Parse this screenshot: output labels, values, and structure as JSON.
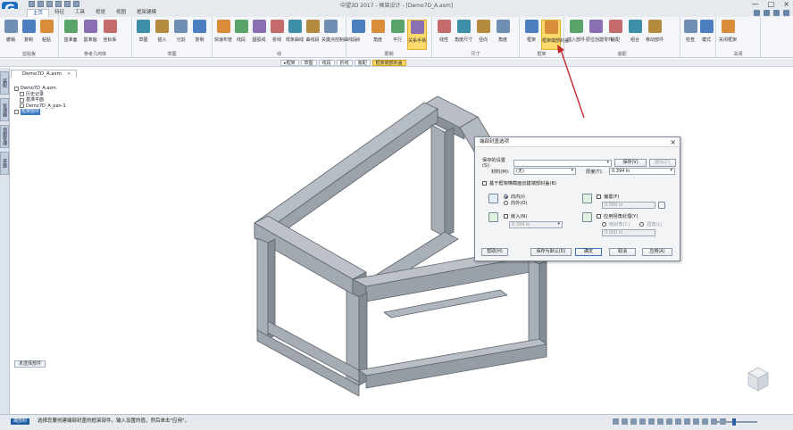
{
  "window": {
    "title": "中望3D 2017 - 框架设计 - [Demo7D_A.asm]",
    "controls": [
      "—",
      "□",
      "×"
    ]
  },
  "ribbon_tabs": [
    {
      "label": "主页",
      "active": true
    },
    {
      "label": "特征",
      "active": false
    },
    {
      "label": "工具",
      "active": false
    },
    {
      "label": "视觉",
      "active": false
    },
    {
      "label": "视图",
      "active": false
    },
    {
      "label": "框架建模",
      "active": false
    }
  ],
  "ribbon": {
    "groups": [
      {
        "label": "剪贴板",
        "buttons": [
          {
            "label": "撤销",
            "icon": "undo-icon"
          },
          {
            "label": "复制",
            "icon": "copy-icon"
          },
          {
            "label": "粘贴",
            "icon": "paste-icon"
          }
        ]
      },
      {
        "label": "参考几何体",
        "buttons": [
          {
            "label": "基准面",
            "icon": "plane-icon"
          },
          {
            "label": "基准轴",
            "icon": "axis-icon"
          },
          {
            "label": "坐标系",
            "icon": "csys-icon"
          }
        ]
      },
      {
        "label": "草图",
        "buttons": [
          {
            "label": "草图",
            "icon": "sketch-icon"
          },
          {
            "label": "插入",
            "icon": "insert-icon"
          },
          {
            "label": "分割",
            "icon": "split-icon"
          },
          {
            "label": "复制",
            "icon": "copy2-icon"
          }
        ]
      },
      {
        "label": "线",
        "buttons": [
          {
            "label": "快速布管",
            "icon": "route-icon"
          },
          {
            "label": "线段",
            "icon": "line-icon"
          },
          {
            "label": "圆弧线",
            "icon": "arc-icon"
          },
          {
            "label": "折线",
            "icon": "polyline-icon"
          },
          {
            "label": "样条曲线",
            "icon": "spline-icon"
          },
          {
            "label": "曲线段",
            "icon": "curve-icon"
          },
          {
            "label": "关键点控制曲线段",
            "icon": "keycurve-icon"
          }
        ]
      },
      {
        "label": "限制",
        "buttons": [
          {
            "label": "点",
            "icon": "point-icon"
          },
          {
            "label": "角度",
            "icon": "angle-icon"
          },
          {
            "label": "平行",
            "icon": "parallel-icon"
          },
          {
            "label": "关系手柄",
            "icon": "relation-icon",
            "highlight": true
          }
        ]
      },
      {
        "label": "尺寸",
        "buttons": [
          {
            "label": "线性",
            "icon": "linear-icon"
          },
          {
            "label": "角度尺寸",
            "icon": "angledim-icon"
          },
          {
            "label": "径向",
            "icon": "radial-icon"
          },
          {
            "label": "角度",
            "icon": "angle2-icon"
          }
        ]
      },
      {
        "label": "框架",
        "buttons": [
          {
            "label": "框架",
            "icon": "frame-icon"
          },
          {
            "label": "框架端部封盖",
            "icon": "endcap-icon",
            "highlight": true
          }
        ]
      },
      {
        "label": "装配",
        "buttons": [
          {
            "label": "插入部件",
            "icon": "insertpart-icon"
          },
          {
            "label": "原位创建零件",
            "icon": "inplace-icon"
          },
          {
            "label": "装配",
            "icon": "assembly-icon"
          },
          {
            "label": "组合",
            "icon": "combine-icon"
          },
          {
            "label": "移动部件",
            "icon": "move-icon"
          }
        ]
      },
      {
        "label": "",
        "buttons": [
          {
            "label": "检查",
            "icon": "check-icon"
          },
          {
            "label": "模式",
            "icon": "mode-icon"
          }
        ]
      },
      {
        "label": "关闭",
        "buttons": [
          {
            "label": "关闭框架",
            "icon": "close-frame-icon"
          }
        ]
      }
    ]
  },
  "breadcrumb": [
    {
      "label": "▸框架",
      "active": false
    },
    {
      "label": "草图",
      "active": false
    },
    {
      "label": "线段",
      "active": false
    },
    {
      "label": "折线",
      "active": false
    },
    {
      "label": "装配",
      "active": false
    },
    {
      "label": "框架端部封盖",
      "active": true
    }
  ],
  "left_rail": [
    "装配",
    "管理器",
    "视图管理",
    "草图"
  ],
  "document_tab": {
    "label": "Demo7D_A.asm",
    "close": "×"
  },
  "tree": [
    {
      "label": "Demo7D_A.asm",
      "indent": 0,
      "selected": false
    },
    {
      "label": "历史记录",
      "indent": 1,
      "selected": false
    },
    {
      "label": "基准平面",
      "indent": 1,
      "selected": false
    },
    {
      "label": "Demo7D_A_pan-1",
      "indent": 1,
      "selected": false
    },
    {
      "label": "框架部件",
      "indent": 0,
      "selected": true
    }
  ],
  "mini_status": "未选择部件",
  "dialog": {
    "title": "端部封盖选项",
    "close": "×",
    "preset_label": "保存的设置(S):",
    "preset_value": "",
    "save_btn": "保存(V)",
    "delete_btn": "删除(D)",
    "material_label": "材料(M):",
    "material_value": "(无)",
    "thickness_label": "厚度(T):",
    "thickness_value": "0.394 in",
    "based_on_label": "基于框架横截面创建端部封盖(B)",
    "direction_inward": "向内(I)",
    "direction_outward": "向外(O)",
    "offset_label": "偏置(F)",
    "offset_value": "0.000 in",
    "inset_label": "嵌入(N)",
    "inset_value": "0.394 in",
    "corner_label": "应用拐角处理(Y)",
    "corner_chamfer": "倒斜角(C)",
    "corner_fillet": "圆角(L)",
    "corner_value": "0.000 in",
    "help_btn": "帮助(H)",
    "save_default_btn": "保存为默认(D)",
    "ok_btn": "确定",
    "cancel_btn": "取消",
    "apply_btn": "应用(A)"
  },
  "status": {
    "tag": "端部封",
    "text": "选择您要创建端部封盖的框架部件。输入设置的值，然后单击\"应用\"。"
  },
  "colors": {
    "highlight": "#fcd96b",
    "accent": "#1a4f8a",
    "model": "#9aa1a9",
    "arrow": "#c1272d"
  }
}
